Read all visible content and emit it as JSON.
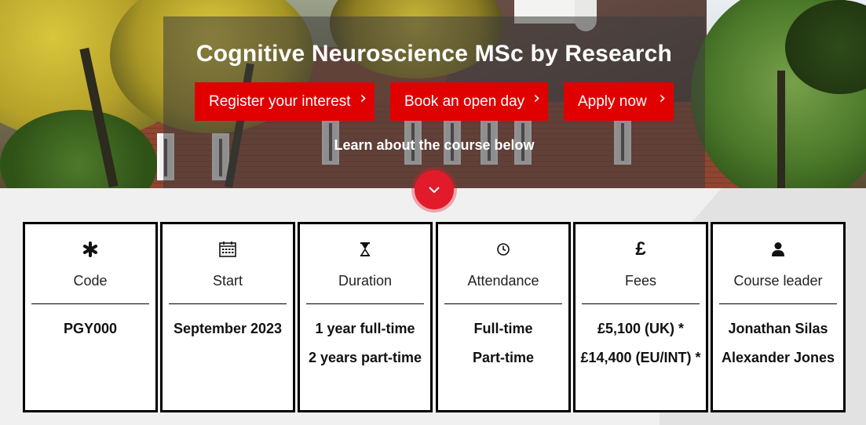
{
  "hero": {
    "title": "Cognitive Neuroscience MSc by Research",
    "buttons": [
      {
        "label": "Register your interest"
      },
      {
        "label": "Book an open day"
      },
      {
        "label": "Apply now"
      }
    ],
    "subtitle": "Learn about the course below"
  },
  "accent_color": "#e00000",
  "cards": [
    {
      "icon": "asterisk-icon",
      "label": "Code",
      "values": [
        "PGY000"
      ]
    },
    {
      "icon": "calendar-icon",
      "label": "Start",
      "values": [
        "September 2023"
      ]
    },
    {
      "icon": "hourglass-icon",
      "label": "Duration",
      "values": [
        "1 year full-time",
        "2 years part-time"
      ]
    },
    {
      "icon": "clock-icon",
      "label": "Attendance",
      "values": [
        "Full-time",
        "Part-time"
      ]
    },
    {
      "icon": "pound-icon",
      "label": "Fees",
      "values": [
        "£5,100 (UK) *",
        "£14,400 (EU/INT) *"
      ]
    },
    {
      "icon": "person-icon",
      "label": "Course leader",
      "values": [
        "Jonathan Silas",
        "Alexander Jones"
      ]
    }
  ]
}
